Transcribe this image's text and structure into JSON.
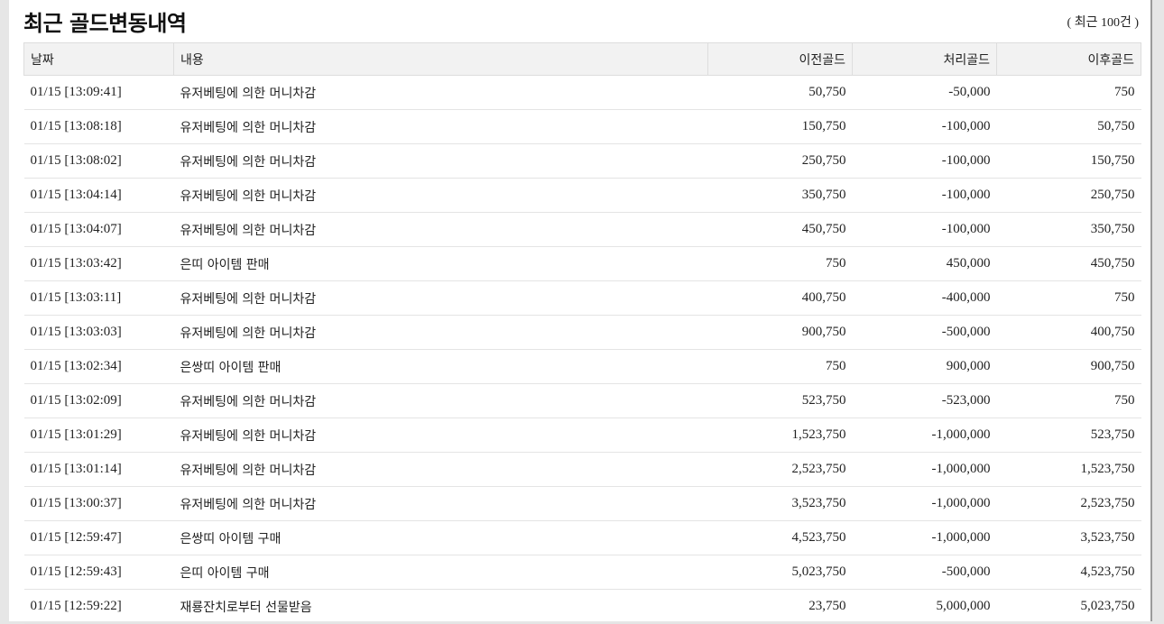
{
  "header": {
    "title": "최근 골드변동내역",
    "count_label": "( 최근 100건 )"
  },
  "table": {
    "columns": [
      "날짜",
      "내용",
      "이전골드",
      "처리골드",
      "이후골드"
    ],
    "rows": [
      {
        "date": "01/15 [13:09:41]",
        "desc": "유저베팅에 의한 머니차감",
        "before": "50,750",
        "change": "-50,000",
        "after": "750"
      },
      {
        "date": "01/15 [13:08:18]",
        "desc": "유저베팅에 의한 머니차감",
        "before": "150,750",
        "change": "-100,000",
        "after": "50,750"
      },
      {
        "date": "01/15 [13:08:02]",
        "desc": "유저베팅에 의한 머니차감",
        "before": "250,750",
        "change": "-100,000",
        "after": "150,750"
      },
      {
        "date": "01/15 [13:04:14]",
        "desc": "유저베팅에 의한 머니차감",
        "before": "350,750",
        "change": "-100,000",
        "after": "250,750"
      },
      {
        "date": "01/15 [13:04:07]",
        "desc": "유저베팅에 의한 머니차감",
        "before": "450,750",
        "change": "-100,000",
        "after": "350,750"
      },
      {
        "date": "01/15 [13:03:42]",
        "desc": "은띠 아이템 판매",
        "before": "750",
        "change": "450,000",
        "after": "450,750"
      },
      {
        "date": "01/15 [13:03:11]",
        "desc": "유저베팅에 의한 머니차감",
        "before": "400,750",
        "change": "-400,000",
        "after": "750"
      },
      {
        "date": "01/15 [13:03:03]",
        "desc": "유저베팅에 의한 머니차감",
        "before": "900,750",
        "change": "-500,000",
        "after": "400,750"
      },
      {
        "date": "01/15 [13:02:34]",
        "desc": "은쌍띠 아이템 판매",
        "before": "750",
        "change": "900,000",
        "after": "900,750"
      },
      {
        "date": "01/15 [13:02:09]",
        "desc": "유저베팅에 의한 머니차감",
        "before": "523,750",
        "change": "-523,000",
        "after": "750"
      },
      {
        "date": "01/15 [13:01:29]",
        "desc": "유저베팅에 의한 머니차감",
        "before": "1,523,750",
        "change": "-1,000,000",
        "after": "523,750"
      },
      {
        "date": "01/15 [13:01:14]",
        "desc": "유저베팅에 의한 머니차감",
        "before": "2,523,750",
        "change": "-1,000,000",
        "after": "1,523,750"
      },
      {
        "date": "01/15 [13:00:37]",
        "desc": "유저베팅에 의한 머니차감",
        "before": "3,523,750",
        "change": "-1,000,000",
        "after": "2,523,750"
      },
      {
        "date": "01/15 [12:59:47]",
        "desc": "은쌍띠 아이템 구매",
        "before": "4,523,750",
        "change": "-1,000,000",
        "after": "3,523,750"
      },
      {
        "date": "01/15 [12:59:43]",
        "desc": "은띠 아이템 구매",
        "before": "5,023,750",
        "change": "-500,000",
        "after": "4,523,750"
      },
      {
        "date": "01/15 [12:59:22]",
        "desc": "재룡잔치로부터 선물받음",
        "before": "23,750",
        "change": "5,000,000",
        "after": "5,023,750"
      }
    ]
  }
}
